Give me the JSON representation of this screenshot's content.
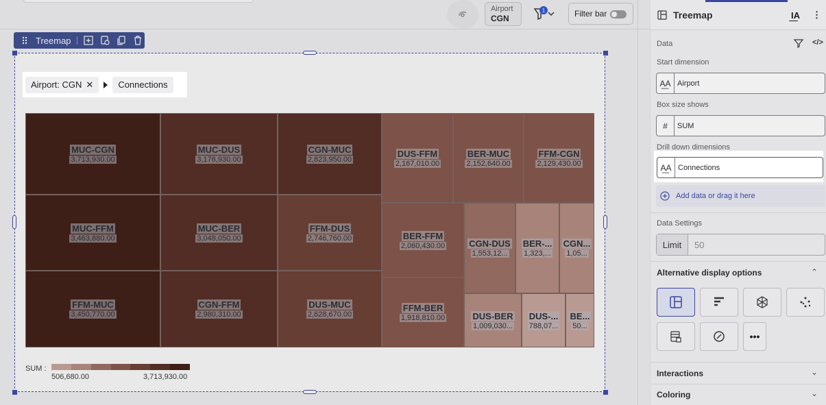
{
  "header": {
    "airport_filter_label": "Airport",
    "airport_filter_value": "CGN",
    "filter_count": "1",
    "filter_bar_label": "Filter bar"
  },
  "widget": {
    "toolbar_title": "Treemap",
    "breadcrumb": {
      "filter_chip": "Airport: CGN",
      "drill_chip": "Connections"
    }
  },
  "chart_data": {
    "type": "treemap",
    "measure": "SUM",
    "dimension": "Connections",
    "tiles": [
      {
        "name": "MUC-CGN",
        "value_label": "3,713,930.00",
        "value": 3713930
      },
      {
        "name": "MUC-FFM",
        "value_label": "3,463,880.00",
        "value": 3463880
      },
      {
        "name": "FFM-MUC",
        "value_label": "3,450,770.00",
        "value": 3450770
      },
      {
        "name": "MUC-DUS",
        "value_label": "3,176,930.00",
        "value": 3176930
      },
      {
        "name": "MUC-BER",
        "value_label": "3,048,050.00",
        "value": 3048050
      },
      {
        "name": "CGN-FFM",
        "value_label": "2,980,310.00",
        "value": 2980310
      },
      {
        "name": "CGN-MUC",
        "value_label": "2,823,950.00",
        "value": 2823950
      },
      {
        "name": "FFM-DUS",
        "value_label": "2,746,760.00",
        "value": 2746760
      },
      {
        "name": "DUS-MUC",
        "value_label": "2,628,670.00",
        "value": 2628670
      },
      {
        "name": "DUS-FFM",
        "value_label": "2,167,010.00",
        "value": 2167010
      },
      {
        "name": "BER-MUC",
        "value_label": "2,152,640.00",
        "value": 2152640
      },
      {
        "name": "FFM-CGN",
        "value_label": "2,129,430.00",
        "value": 2129430
      },
      {
        "name": "BER-FFM",
        "value_label": "2,060,430.00",
        "value": 2060430
      },
      {
        "name": "FFM-BER",
        "value_label": "1,918,810.00",
        "value": 1918810
      },
      {
        "name": "CGN-DUS",
        "value_label": "1,553,12...",
        "value": 1553120
      },
      {
        "name": "BER-...",
        "value_label": "1,323,...",
        "value": 1323000
      },
      {
        "name": "CGN...",
        "value_label": "1,05...",
        "value": 1050000
      },
      {
        "name": "DUS-BER",
        "value_label": "1,009,030...",
        "value": 1009030
      },
      {
        "name": "DUS-...",
        "value_label": "788,07...",
        "value": 788070
      },
      {
        "name": "BE...",
        "value_label": "50...",
        "value": 506680
      }
    ],
    "legend": {
      "title": "SUM :",
      "min_label": "506,680.00",
      "max_label": "3,713,930.00",
      "min": 506680,
      "max": 3713930,
      "colors": [
        "#c9a59d",
        "#b48b80",
        "#9c6e62",
        "#845448",
        "#6b3d32",
        "#532a20",
        "#3c1a12"
      ]
    }
  },
  "panel": {
    "title": "Treemap",
    "data_section": "Data",
    "start_dimension_label": "Start dimension",
    "start_dimension_value": "Airport",
    "box_size_label": "Box size shows",
    "box_size_value": "SUM",
    "drill_down_label": "Drill down dimensions",
    "drill_down_value": "Connections",
    "add_data": "Add data or drag it here",
    "data_settings": "Data Settings",
    "limit_label": "Limit",
    "limit_placeholder": "50",
    "alt_display": "Alternative display options",
    "interactions": "Interactions",
    "coloring": "Coloring"
  }
}
